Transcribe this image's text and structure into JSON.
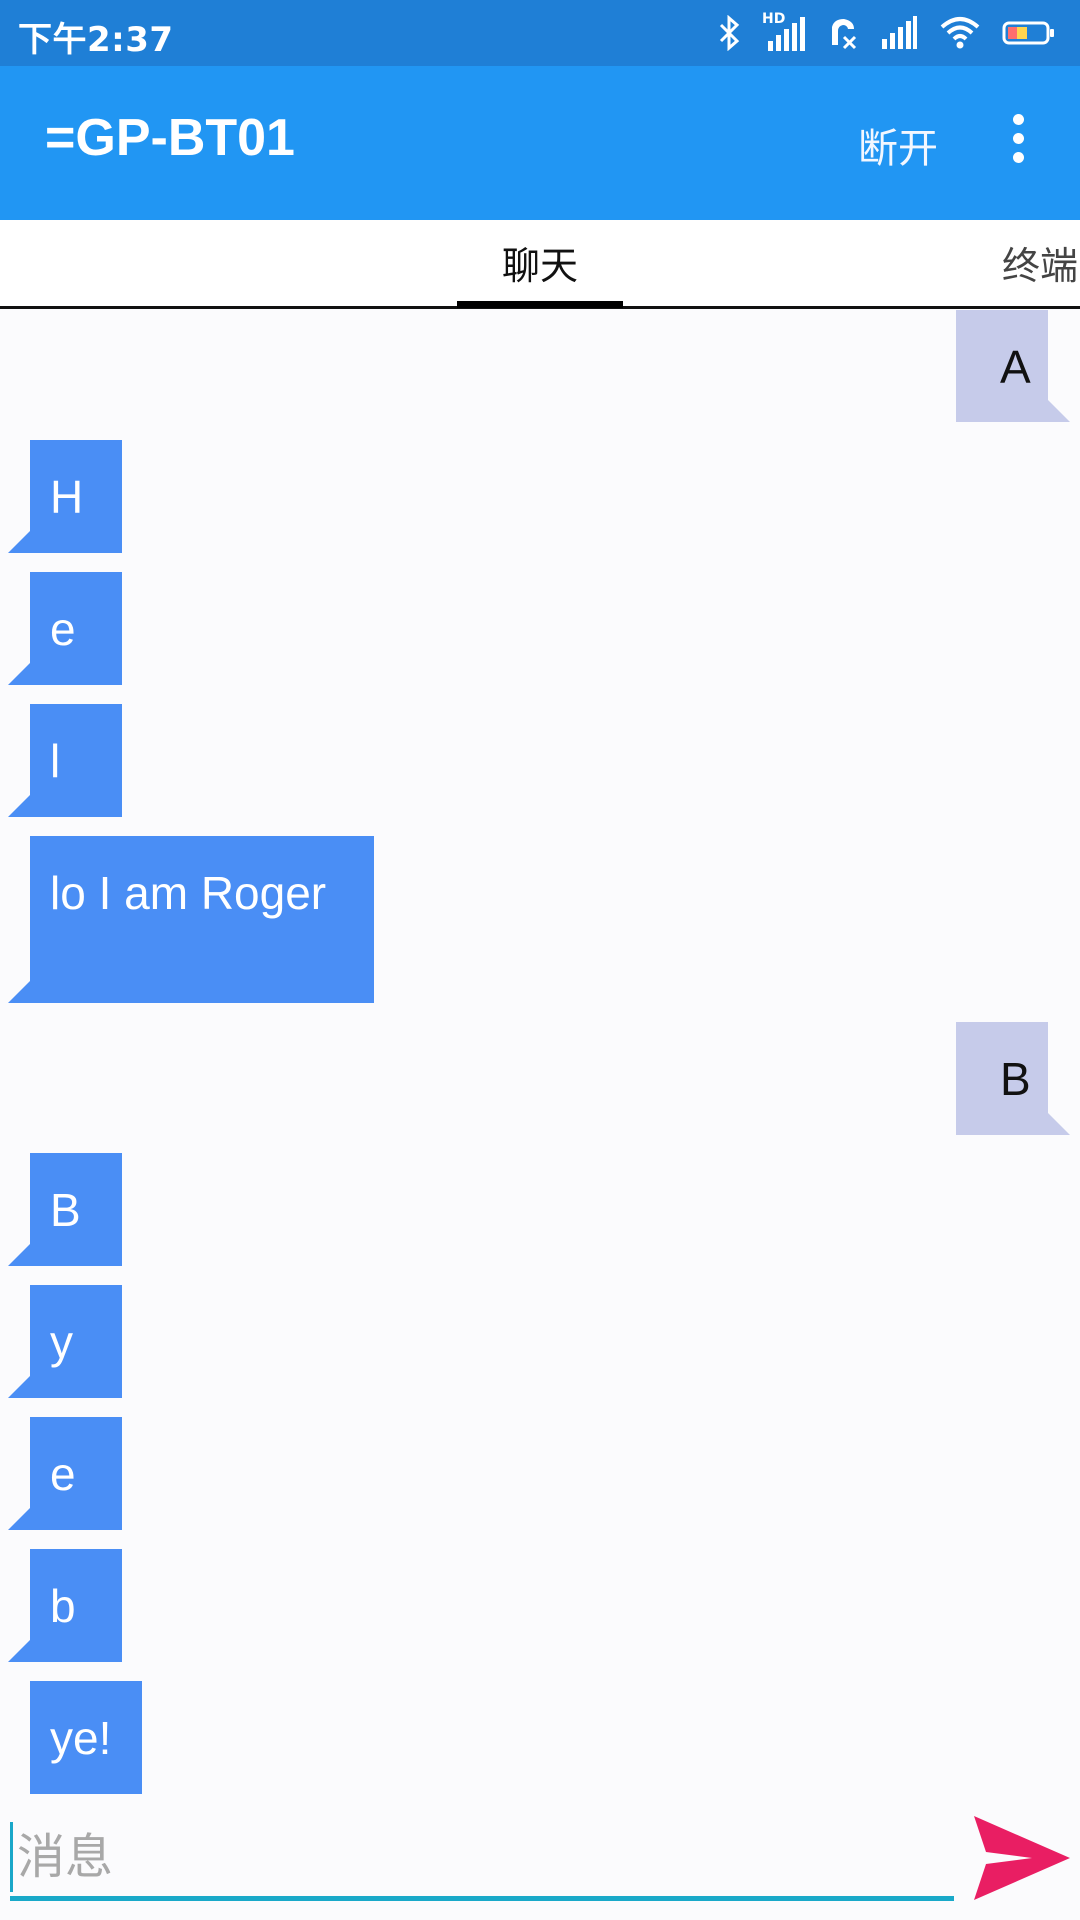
{
  "status_bar": {
    "time": "下午2:37",
    "icons": [
      "bluetooth-icon",
      "hd-signal-icon",
      "call-blocked-icon",
      "signal-icon",
      "wifi-icon",
      "battery-icon"
    ],
    "hd_label": "HD"
  },
  "app_bar": {
    "title": "=GP-BT01",
    "disconnect_label": "断开",
    "menu_icon": "more-vert-icon"
  },
  "tabs": [
    {
      "label": "聊天",
      "selected": true
    },
    {
      "label": "终端",
      "selected": false
    }
  ],
  "messages": [
    {
      "side": "out",
      "text": "A"
    },
    {
      "side": "in",
      "text": "H"
    },
    {
      "side": "in",
      "text": "e"
    },
    {
      "side": "in",
      "text": "l"
    },
    {
      "side": "in",
      "text": "lo I am Roger"
    },
    {
      "side": "out",
      "text": "B"
    },
    {
      "side": "in",
      "text": "B"
    },
    {
      "side": "in",
      "text": "y"
    },
    {
      "side": "in",
      "text": "e"
    },
    {
      "side": "in",
      "text": "b"
    },
    {
      "side": "in",
      "text": "ye!"
    }
  ],
  "input": {
    "placeholder": "消息",
    "value": ""
  },
  "send": {
    "icon": "send-icon"
  },
  "colors": {
    "status_bar": "#1f7fd6",
    "app_bar": "#2196f3",
    "incoming_bubble": "#4a8ef5",
    "outgoing_bubble": "#c6cbea",
    "input_underline": "#19a9c9",
    "send_button": "#e91e63"
  }
}
